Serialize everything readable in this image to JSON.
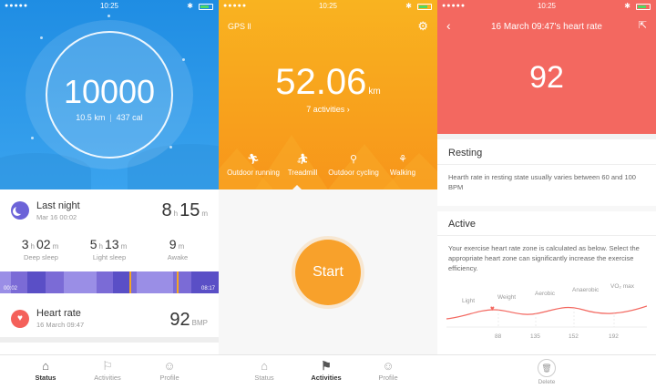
{
  "status_bar": {
    "time": "10:25",
    "bluetooth_icon": "bluetooth-icon",
    "battery_icon": "battery-icon"
  },
  "status_panel": {
    "steps": "10000",
    "distance": "10.5 km",
    "calories": "437 cal",
    "last_night": {
      "title": "Last night",
      "date": "Mar 16 00:02",
      "hours": "8",
      "hours_unit": "h",
      "minutes": "15",
      "minutes_unit": "m",
      "deep": {
        "h": "3",
        "m": "02",
        "label": "Deep sleep"
      },
      "light": {
        "h": "5",
        "m": "13",
        "label": "Light sleep"
      },
      "awake": {
        "m": "9",
        "label": "Awake"
      },
      "bar_start": "00:02",
      "bar_end": "08:17",
      "unit_h": "h",
      "unit_m": "m"
    },
    "heart_rate": {
      "title": "Heart rate",
      "date": "16 March 09:47",
      "value": "92",
      "unit": "BMP"
    },
    "tabs": [
      {
        "label": "Status",
        "icon": "home-icon"
      },
      {
        "label": "Activities",
        "icon": "flag-icon"
      },
      {
        "label": "Profile",
        "icon": "person-icon"
      }
    ]
  },
  "activities_panel": {
    "gps_label": "GPS",
    "distance_value": "52.06",
    "distance_unit": "km",
    "activities_count": "7 activities",
    "modes": [
      {
        "label": "Outdoor running",
        "icon": "running-icon"
      },
      {
        "label": "Treadmill",
        "icon": "treadmill-icon"
      },
      {
        "label": "Outdoor cycling",
        "icon": "cycling-icon"
      },
      {
        "label": "Walking",
        "icon": "walking-icon"
      }
    ],
    "selected_mode": "Treadmill",
    "start_label": "Start",
    "tabs": [
      {
        "label": "Status",
        "icon": "home-icon"
      },
      {
        "label": "Activities",
        "icon": "flag-icon"
      },
      {
        "label": "Profile",
        "icon": "person-icon"
      }
    ]
  },
  "heart_rate_panel": {
    "title": "16 March 09:47's heart rate",
    "value": "92",
    "resting": {
      "heading": "Resting",
      "text": "Hearth rate in resting state usually varies between 60 and 100 BPM"
    },
    "active": {
      "heading": "Active",
      "text": "Your exercise heart rate zone is calculated as below. Select the appropriate heart zone can significantly increase the exercise efficiency."
    },
    "zones": [
      "Light",
      "Weight",
      "Aerobic",
      "Anaerobic",
      "VO₂ max"
    ],
    "zone_ticks": [
      "88",
      "135",
      "152",
      "192"
    ],
    "delete_label": "Delete",
    "colors": {
      "accent": "#f36860"
    }
  }
}
